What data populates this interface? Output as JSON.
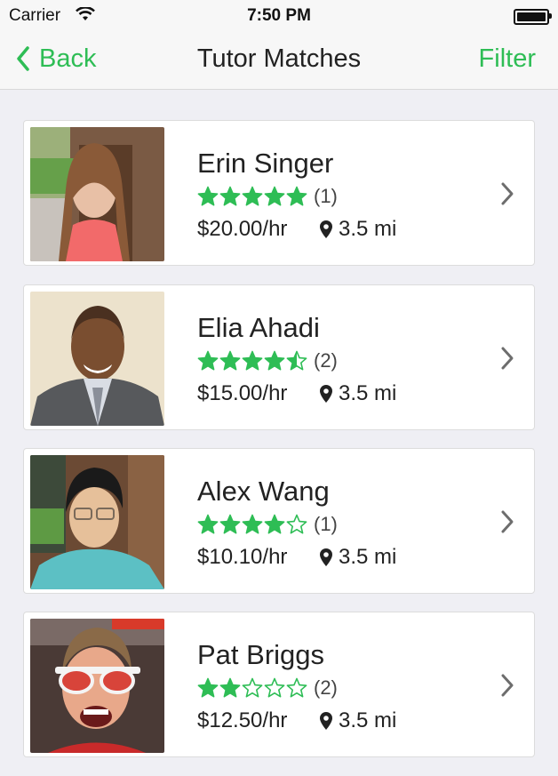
{
  "status": {
    "carrier": "Carrier",
    "time": "7:50 PM"
  },
  "nav": {
    "back_label": "Back",
    "title": "Tutor Matches",
    "filter_label": "Filter"
  },
  "colors": {
    "accent": "#2ebd55",
    "background": "#efeff4"
  },
  "tutors": [
    {
      "name": "Erin Singer",
      "rating": 5,
      "reviews": "(1)",
      "price": "$20.00/hr",
      "distance": "3.5 mi"
    },
    {
      "name": "Elia Ahadi",
      "rating": 4.5,
      "reviews": "(2)",
      "price": "$15.00/hr",
      "distance": "3.5 mi"
    },
    {
      "name": "Alex Wang",
      "rating": 4,
      "reviews": "(1)",
      "price": "$10.10/hr",
      "distance": "3.5 mi"
    },
    {
      "name": "Pat Briggs",
      "rating": 2,
      "reviews": "(2)",
      "price": "$12.50/hr",
      "distance": "3.5 mi"
    }
  ],
  "icons": {
    "back": "chevron-left-icon",
    "row": "chevron-right-icon",
    "distance": "location-pin-icon",
    "rating": "star-icon"
  }
}
